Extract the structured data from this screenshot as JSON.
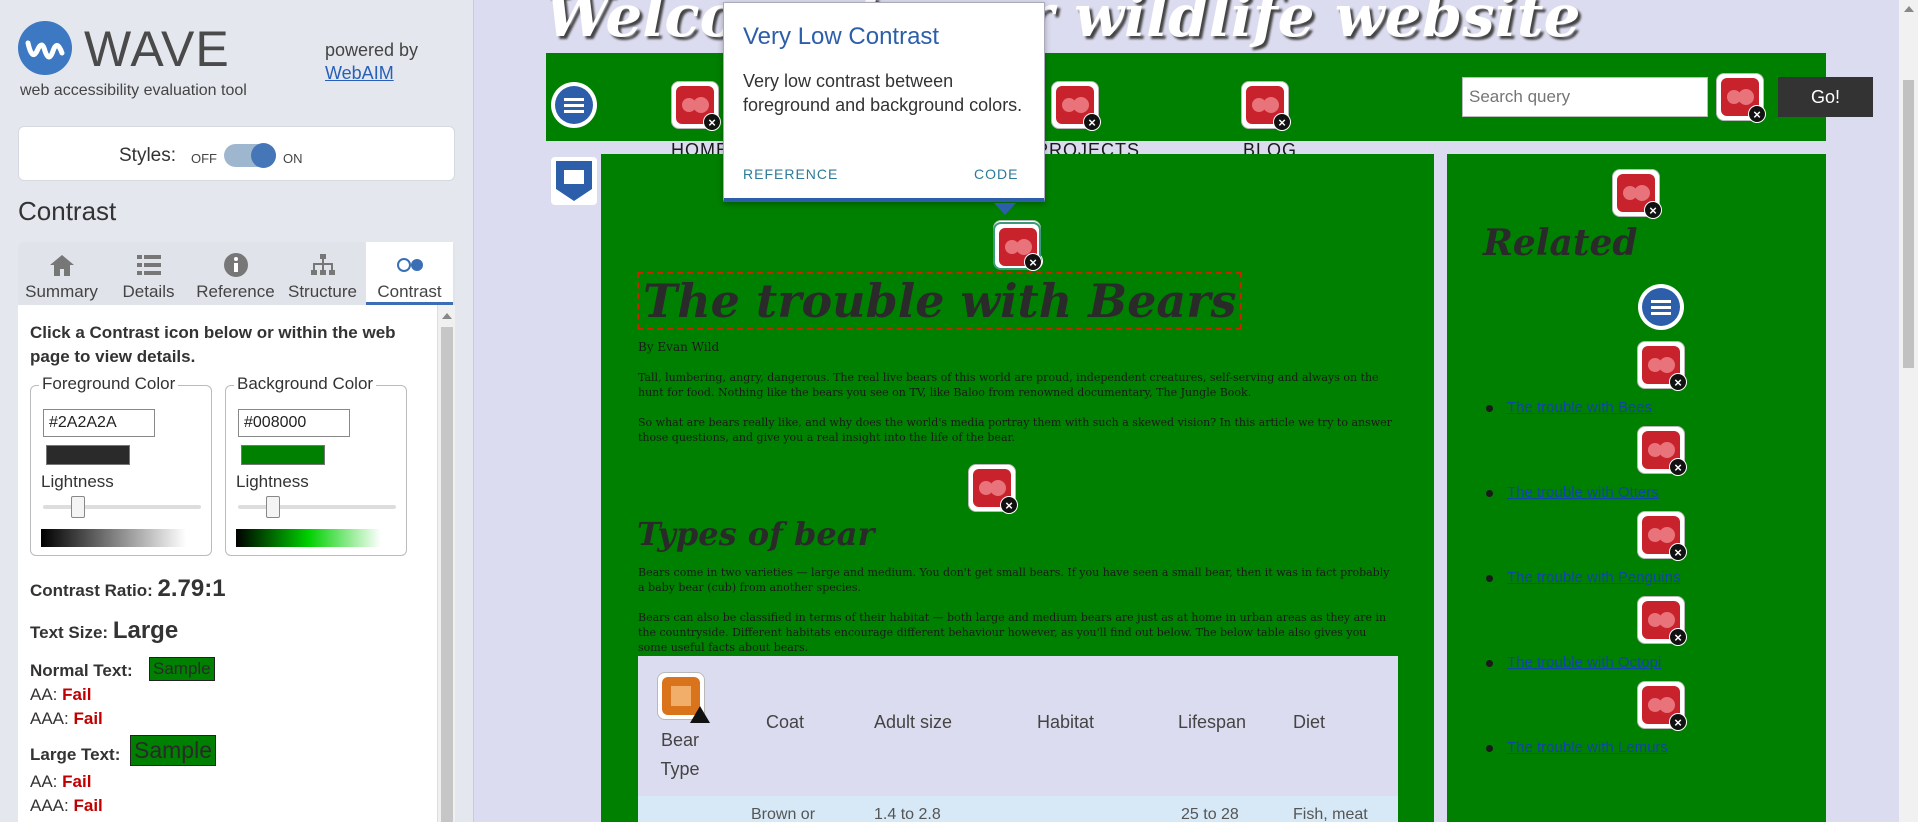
{
  "wave": {
    "logo_text": "WAVE",
    "logo_sub": "web accessibility evaluation tool",
    "powered_by": "powered by",
    "powered_link": "WebAIM",
    "styles_label": "Styles:",
    "styles_off": "OFF",
    "styles_on": "ON",
    "section_title": "Contrast",
    "tabs": [
      {
        "label": "Summary",
        "icon": "home-icon"
      },
      {
        "label": "Details",
        "icon": "list-icon"
      },
      {
        "label": "Reference",
        "icon": "info-icon"
      },
      {
        "label": "Structure",
        "icon": "structure-icon"
      },
      {
        "label": "Contrast",
        "icon": "contrast-icon"
      }
    ],
    "active_tab": "Contrast",
    "instructions": "Click a Contrast icon below or within the web page to view details.",
    "foreground": {
      "legend": "Foreground Color",
      "value": "#2A2A2A",
      "lightness_label": "Lightness",
      "color": "#2a2a2a"
    },
    "background": {
      "legend": "Background Color",
      "value": "#008000",
      "lightness_label": "Lightness",
      "color": "#008000"
    },
    "ratio_label": "Contrast Ratio:",
    "ratio_value": "2.79:1",
    "text_size_label": "Text Size:",
    "text_size_value": "Large",
    "normal_text_label": "Normal Text:",
    "large_text_label": "Large Text:",
    "sample": "Sample",
    "aa_label": "AA:",
    "aaa_label": "AAA:",
    "fail": "Fail"
  },
  "site": {
    "title": "Welcome to our wildlife website",
    "nav": [
      "HOME",
      "PROJECTS",
      "BLOG"
    ],
    "search_placeholder": "Search query",
    "go_label": "Go!",
    "h1": "The trouble with Bears",
    "byline": "By Evan Wild",
    "p1": "Tall, lumbering, angry, dangerous. The real live bears of this world are proud, independent creatures, self-serving and always on the hunt for food. Nothing like the bears you see on TV, like Baloo from renowned documentary, The Jungle Book.",
    "p2": "So what are bears really like, and why does the world's media portray them with such a skewed vision? In this article we try to answer those questions, and give you a real insight into the life of the bear.",
    "h2": "Types of bear",
    "p3": "Bears come in two varieties — large and medium. You don't get small bears. If you have seen a small bear, then it was in fact probably a baby bear (cub) from another species.",
    "p4": "Bears can also be classified in terms of their habitat — both large and medium bears are just as at home in urban areas as they are in the countryside. Different habitats encourage different behaviour however, as you'll find out below. The below table also gives you some useful facts about bears.",
    "table_headers": [
      "Bear Type",
      "Coat",
      "Adult size",
      "Habitat",
      "Lifespan",
      "Diet"
    ],
    "table_row_partial": [
      "Brown or",
      "1.4 to 2.8",
      "25 to 28",
      "Fish, meat"
    ],
    "aside_title": "Related",
    "aside_links": [
      "The trouble with Bees",
      "The trouble with Otters",
      "The trouble with Penguins",
      "The trouble with Octopi",
      "The trouble with Lemurs"
    ]
  },
  "popup": {
    "title": "Very Low Contrast",
    "body": "Very low contrast between foreground and background colors.",
    "reference": "REFERENCE",
    "code": "CODE"
  }
}
